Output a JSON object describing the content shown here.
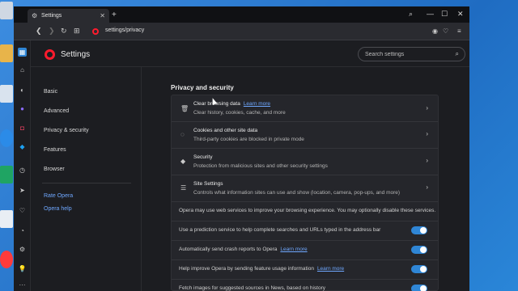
{
  "tab": {
    "icon": "gear-icon",
    "title": "Settings",
    "close": "✕"
  },
  "window_controls": {
    "search": "🔍",
    "minimize": "—",
    "maximize": "☐",
    "close": "✕"
  },
  "address_bar": {
    "url": "settings/privacy"
  },
  "settings_header": {
    "title": "Settings",
    "search_placeholder": "Search settings"
  },
  "nav": {
    "items": [
      "Basic",
      "Advanced",
      "Privacy & security",
      "Features",
      "Browser"
    ],
    "links": [
      "Rate Opera",
      "Opera help"
    ]
  },
  "main": {
    "section_title": "Privacy and security",
    "rows": [
      {
        "icon": "trash-icon",
        "title": "Clear browsing data",
        "link": "Learn more",
        "desc": "Clear history, cookies, cache, and more"
      },
      {
        "icon": "cookie-icon",
        "title": "Cookies and other site data",
        "desc": "Third-party cookies are blocked in private mode"
      },
      {
        "icon": "shield-icon",
        "title": "Security",
        "desc": "Protection from malicious sites and other security settings"
      },
      {
        "icon": "sliders-icon",
        "title": "Site Settings",
        "desc": "Controls what information sites can use and show (location, camera, pop-ups, and more)"
      }
    ],
    "web_services_note": "Opera may use web services to improve your browsing experience. You may optionally disable these services.",
    "toggles": [
      {
        "label": "Use a prediction service to help complete searches and URLs typed in the address bar",
        "link": "",
        "on": true
      },
      {
        "label": "Automatically send crash reports to Opera",
        "link": "Learn more",
        "on": true
      },
      {
        "label": "Help improve Opera by sending feature usage information",
        "link": "Learn more",
        "on": true
      },
      {
        "label": "Fetch images for suggested sources in News, based on history",
        "link": "",
        "on": true
      }
    ]
  },
  "colors": {
    "accent": "#2f86d6",
    "opera_red": "#ff1b2d",
    "link": "#6fa8ff"
  }
}
